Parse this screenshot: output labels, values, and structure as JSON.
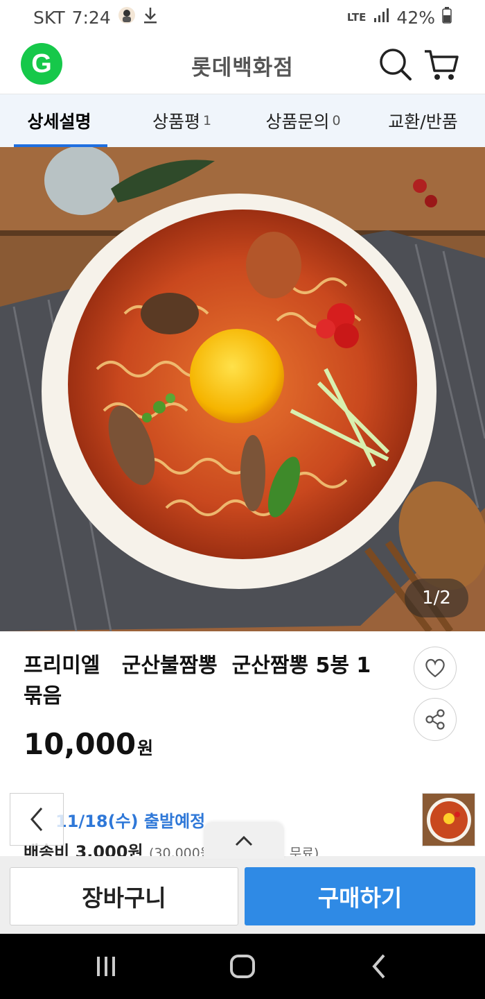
{
  "status_bar": {
    "carrier": "SKT",
    "time": "7:24",
    "network": "LTE",
    "battery": "42%"
  },
  "header": {
    "logo_letter": "G",
    "store_name": "롯데백화점",
    "icons": [
      "search-icon",
      "cart-icon"
    ],
    "logo_color": "#16c84a"
  },
  "tabs": [
    {
      "label": "상세설명",
      "count": ""
    },
    {
      "label": "상품평",
      "count": "1"
    },
    {
      "label": "상품문의",
      "count": "0"
    },
    {
      "label": "교환/반품",
      "count": ""
    }
  ],
  "hero": {
    "image_counter": "1/2"
  },
  "product": {
    "name": "프리미엘   군산불짬뽕  군산짬뽕 5봉 1묶음",
    "price_number": "10,000",
    "price_unit": "원"
  },
  "shipping": {
    "date": "11/18(수) 출발예정",
    "fee": "배송비 3,000원",
    "note": "(30,000원 이상 구매 시 무료)"
  },
  "bottom_bar": {
    "cart_label": "장바구니",
    "buy_label": "구매하기",
    "buy_color": "#2f8ae5"
  },
  "nav_bar": {
    "icons": [
      "recent-apps-icon",
      "home-icon",
      "back-icon"
    ]
  }
}
